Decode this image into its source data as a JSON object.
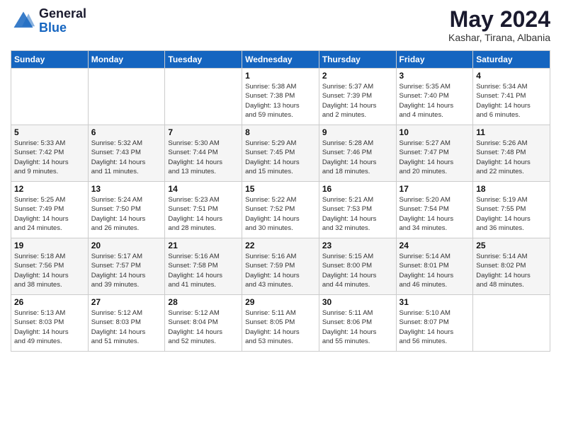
{
  "logo": {
    "general": "General",
    "blue": "Blue"
  },
  "title": "May 2024",
  "location": "Kashar, Tirana, Albania",
  "days_of_week": [
    "Sunday",
    "Monday",
    "Tuesday",
    "Wednesday",
    "Thursday",
    "Friday",
    "Saturday"
  ],
  "weeks": [
    [
      {
        "day": "",
        "info": ""
      },
      {
        "day": "",
        "info": ""
      },
      {
        "day": "",
        "info": ""
      },
      {
        "day": "1",
        "info": "Sunrise: 5:38 AM\nSunset: 7:38 PM\nDaylight: 13 hours\nand 59 minutes."
      },
      {
        "day": "2",
        "info": "Sunrise: 5:37 AM\nSunset: 7:39 PM\nDaylight: 14 hours\nand 2 minutes."
      },
      {
        "day": "3",
        "info": "Sunrise: 5:35 AM\nSunset: 7:40 PM\nDaylight: 14 hours\nand 4 minutes."
      },
      {
        "day": "4",
        "info": "Sunrise: 5:34 AM\nSunset: 7:41 PM\nDaylight: 14 hours\nand 6 minutes."
      }
    ],
    [
      {
        "day": "5",
        "info": "Sunrise: 5:33 AM\nSunset: 7:42 PM\nDaylight: 14 hours\nand 9 minutes."
      },
      {
        "day": "6",
        "info": "Sunrise: 5:32 AM\nSunset: 7:43 PM\nDaylight: 14 hours\nand 11 minutes."
      },
      {
        "day": "7",
        "info": "Sunrise: 5:30 AM\nSunset: 7:44 PM\nDaylight: 14 hours\nand 13 minutes."
      },
      {
        "day": "8",
        "info": "Sunrise: 5:29 AM\nSunset: 7:45 PM\nDaylight: 14 hours\nand 15 minutes."
      },
      {
        "day": "9",
        "info": "Sunrise: 5:28 AM\nSunset: 7:46 PM\nDaylight: 14 hours\nand 18 minutes."
      },
      {
        "day": "10",
        "info": "Sunrise: 5:27 AM\nSunset: 7:47 PM\nDaylight: 14 hours\nand 20 minutes."
      },
      {
        "day": "11",
        "info": "Sunrise: 5:26 AM\nSunset: 7:48 PM\nDaylight: 14 hours\nand 22 minutes."
      }
    ],
    [
      {
        "day": "12",
        "info": "Sunrise: 5:25 AM\nSunset: 7:49 PM\nDaylight: 14 hours\nand 24 minutes."
      },
      {
        "day": "13",
        "info": "Sunrise: 5:24 AM\nSunset: 7:50 PM\nDaylight: 14 hours\nand 26 minutes."
      },
      {
        "day": "14",
        "info": "Sunrise: 5:23 AM\nSunset: 7:51 PM\nDaylight: 14 hours\nand 28 minutes."
      },
      {
        "day": "15",
        "info": "Sunrise: 5:22 AM\nSunset: 7:52 PM\nDaylight: 14 hours\nand 30 minutes."
      },
      {
        "day": "16",
        "info": "Sunrise: 5:21 AM\nSunset: 7:53 PM\nDaylight: 14 hours\nand 32 minutes."
      },
      {
        "day": "17",
        "info": "Sunrise: 5:20 AM\nSunset: 7:54 PM\nDaylight: 14 hours\nand 34 minutes."
      },
      {
        "day": "18",
        "info": "Sunrise: 5:19 AM\nSunset: 7:55 PM\nDaylight: 14 hours\nand 36 minutes."
      }
    ],
    [
      {
        "day": "19",
        "info": "Sunrise: 5:18 AM\nSunset: 7:56 PM\nDaylight: 14 hours\nand 38 minutes."
      },
      {
        "day": "20",
        "info": "Sunrise: 5:17 AM\nSunset: 7:57 PM\nDaylight: 14 hours\nand 39 minutes."
      },
      {
        "day": "21",
        "info": "Sunrise: 5:16 AM\nSunset: 7:58 PM\nDaylight: 14 hours\nand 41 minutes."
      },
      {
        "day": "22",
        "info": "Sunrise: 5:16 AM\nSunset: 7:59 PM\nDaylight: 14 hours\nand 43 minutes."
      },
      {
        "day": "23",
        "info": "Sunrise: 5:15 AM\nSunset: 8:00 PM\nDaylight: 14 hours\nand 44 minutes."
      },
      {
        "day": "24",
        "info": "Sunrise: 5:14 AM\nSunset: 8:01 PM\nDaylight: 14 hours\nand 46 minutes."
      },
      {
        "day": "25",
        "info": "Sunrise: 5:14 AM\nSunset: 8:02 PM\nDaylight: 14 hours\nand 48 minutes."
      }
    ],
    [
      {
        "day": "26",
        "info": "Sunrise: 5:13 AM\nSunset: 8:03 PM\nDaylight: 14 hours\nand 49 minutes."
      },
      {
        "day": "27",
        "info": "Sunrise: 5:12 AM\nSunset: 8:03 PM\nDaylight: 14 hours\nand 51 minutes."
      },
      {
        "day": "28",
        "info": "Sunrise: 5:12 AM\nSunset: 8:04 PM\nDaylight: 14 hours\nand 52 minutes."
      },
      {
        "day": "29",
        "info": "Sunrise: 5:11 AM\nSunset: 8:05 PM\nDaylight: 14 hours\nand 53 minutes."
      },
      {
        "day": "30",
        "info": "Sunrise: 5:11 AM\nSunset: 8:06 PM\nDaylight: 14 hours\nand 55 minutes."
      },
      {
        "day": "31",
        "info": "Sunrise: 5:10 AM\nSunset: 8:07 PM\nDaylight: 14 hours\nand 56 minutes."
      },
      {
        "day": "",
        "info": ""
      }
    ]
  ]
}
